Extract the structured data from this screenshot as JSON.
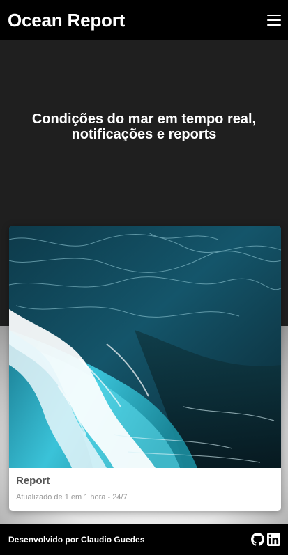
{
  "navbar": {
    "brand": "Ocean Report",
    "menu_icon": "hamburger-menu-icon"
  },
  "hero": {
    "title_line1": "Condições do mar em tempo real,",
    "title_line2": "notificações e reports"
  },
  "card": {
    "image_icon": "ocean-wave-photo",
    "title": "Report",
    "subtitle": "Atualizado de 1 em 1 hora - 24/7"
  },
  "footer": {
    "credit": "Desenvolvido por Claudio Guedes",
    "icons": [
      "github-icon",
      "linkedin-icon"
    ]
  },
  "colors": {
    "navbar_bg": "#000000",
    "hero_bg": "#1f1f1f",
    "card_bg": "#ffffff",
    "card_title": "#555555",
    "card_subtitle": "#999999"
  }
}
